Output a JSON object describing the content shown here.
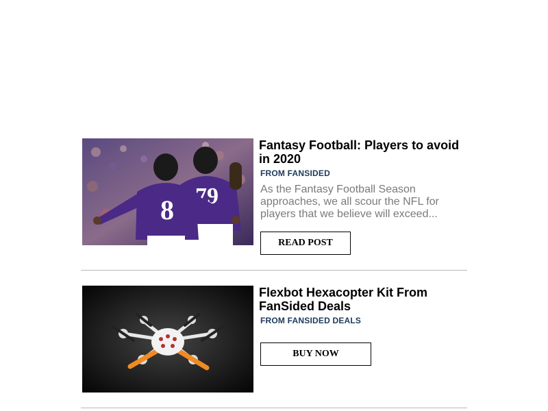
{
  "articles": [
    {
      "title": "Fantasy Football: Players to avoid in 2020",
      "source": "FROM FANSIDED",
      "excerpt": "As the Fantasy Football Season approaches, we all scour the NFL for players that we believe will exceed...",
      "cta": "READ POST",
      "image_icon": "football-players-photo",
      "jersey_numbers": [
        "8",
        "79"
      ]
    },
    {
      "title": "Flexbot Hexacopter Kit From FanSided Deals",
      "source": "FROM FANSIDED DEALS",
      "excerpt": "",
      "cta": "BUY NOW",
      "image_icon": "hexacopter-drone-photo"
    }
  ],
  "colors": {
    "source_text": "#1c3a5a",
    "excerpt_text": "#7a7a7a",
    "divider": "#b9b9b9",
    "jersey_purple": "#4a2a86",
    "propeller_orange": "#f08a24"
  }
}
